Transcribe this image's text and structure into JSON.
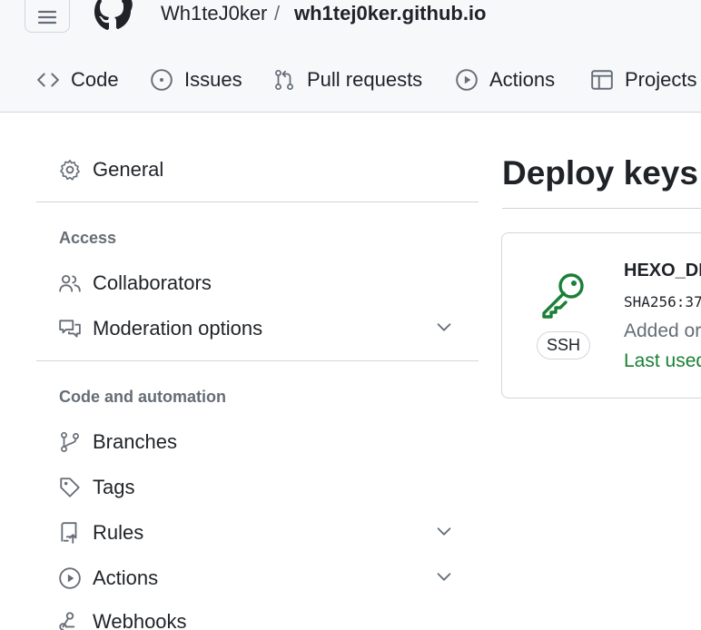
{
  "header": {
    "owner": "Wh1teJ0ker",
    "separator": "/",
    "repo": "wh1tej0ker.github.io",
    "tabs": [
      {
        "label": "Code",
        "icon": "code-icon"
      },
      {
        "label": "Issues",
        "icon": "issue-opened-icon"
      },
      {
        "label": "Pull requests",
        "icon": "git-pull-request-icon"
      },
      {
        "label": "Actions",
        "icon": "play-icon"
      },
      {
        "label": "Projects",
        "icon": "table-icon"
      }
    ]
  },
  "sidebar": {
    "general": "General",
    "access_heading": "Access",
    "collaborators": "Collaborators",
    "moderation": "Moderation options",
    "code_heading": "Code and automation",
    "branches": "Branches",
    "tags": "Tags",
    "rules": "Rules",
    "actions": "Actions",
    "webhooks": "Webhooks"
  },
  "main": {
    "title": "Deploy keys",
    "key": {
      "title": "HEXO_DI",
      "fingerprint": "SHA256:37",
      "added": "Added or",
      "last_used": "Last used",
      "badge": "SSH"
    }
  },
  "colors": {
    "accent_green": "#1a7f37",
    "muted": "#656d76",
    "border": "#d0d7de",
    "header_bg": "#f6f8fa"
  }
}
